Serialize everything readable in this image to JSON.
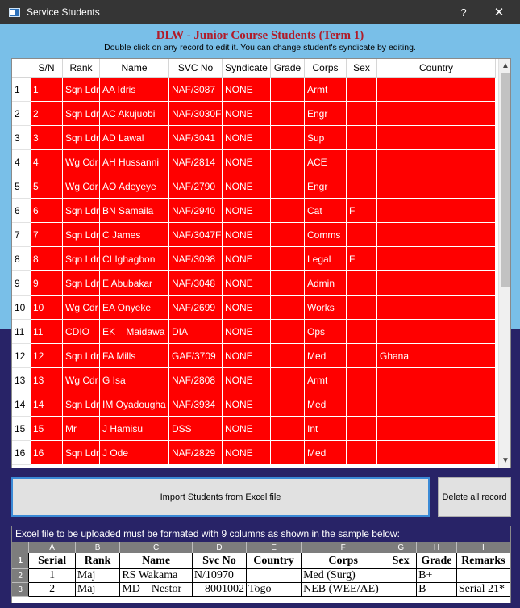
{
  "window": {
    "title": "Service Students",
    "help_label": "?",
    "close_label": "✕"
  },
  "heading": "DLW - Junior Course Students (Term 1)",
  "subheading": "Double click on any record to edit it. You can change student's syndicate by editing.",
  "colors": {
    "row_bg": "#ff0000",
    "top_bg": "#79bfe8",
    "bottom_bg": "#282367",
    "heading": "#b01c2a"
  },
  "table": {
    "columns": [
      "S/N",
      "Rank",
      "Name",
      "SVC No",
      "Syndicate",
      "Grade",
      "Corps",
      "Sex",
      "Country"
    ],
    "rows": [
      {
        "rn": "1",
        "sn": "1",
        "rank": "Sqn Ldr",
        "name": "AA Idris",
        "svc": "NAF/3087",
        "syndicate": "NONE",
        "grade": "",
        "corps": "Armt",
        "sex": "",
        "country": ""
      },
      {
        "rn": "2",
        "sn": "2",
        "rank": "Sqn Ldr",
        "name": "AC Akujuobi",
        "svc": "NAF/3030F",
        "syndicate": "NONE",
        "grade": "",
        "corps": "Engr",
        "sex": "",
        "country": ""
      },
      {
        "rn": "3",
        "sn": "3",
        "rank": "Sqn Ldr",
        "name": "AD Lawal",
        "svc": "NAF/3041",
        "syndicate": "NONE",
        "grade": "",
        "corps": "Sup",
        "sex": "",
        "country": ""
      },
      {
        "rn": "4",
        "sn": "4",
        "rank": "Wg Cdr",
        "name": "AH Hussanni",
        "svc": "NAF/2814",
        "syndicate": "NONE",
        "grade": "",
        "corps": "ACE",
        "sex": "",
        "country": ""
      },
      {
        "rn": "5",
        "sn": "5",
        "rank": "Wg Cdr",
        "name": "AO Adeyeye",
        "svc": "NAF/2790",
        "syndicate": "NONE",
        "grade": "",
        "corps": "Engr",
        "sex": "",
        "country": ""
      },
      {
        "rn": "6",
        "sn": "6",
        "rank": "Sqn Ldr",
        "name": "BN Samaila",
        "svc": "NAF/2940",
        "syndicate": "NONE",
        "grade": "",
        "corps": "Cat",
        "sex": "F",
        "country": ""
      },
      {
        "rn": "7",
        "sn": "7",
        "rank": "Sqn Ldr",
        "name": "C James",
        "svc": "NAF/3047F",
        "syndicate": "NONE",
        "grade": "",
        "corps": "Comms",
        "sex": "",
        "country": ""
      },
      {
        "rn": "8",
        "sn": "8",
        "rank": "Sqn Ldr",
        "name": "CI Ighagbon",
        "svc": "NAF/3098",
        "syndicate": "NONE",
        "grade": "",
        "corps": "Legal",
        "sex": "F",
        "country": ""
      },
      {
        "rn": "9",
        "sn": "9",
        "rank": "Sqn Ldr",
        "name": "E Abubakar",
        "svc": "NAF/3048",
        "syndicate": "NONE",
        "grade": "",
        "corps": "Admin",
        "sex": "",
        "country": ""
      },
      {
        "rn": "10",
        "sn": "10",
        "rank": "Wg Cdr",
        "name": "EA Onyeke",
        "svc": "NAF/2699",
        "syndicate": "NONE",
        "grade": "",
        "corps": "Works",
        "sex": "",
        "country": ""
      },
      {
        "rn": "11",
        "sn": "11",
        "rank": "CDIO",
        "name": "EK    Maidawa",
        "svc": "DIA",
        "syndicate": "NONE",
        "grade": "",
        "corps": "Ops",
        "sex": "",
        "country": ""
      },
      {
        "rn": "12",
        "sn": "12",
        "rank": "Sqn Ldr",
        "name": "FA Mills",
        "svc": "GAF/3709",
        "syndicate": "NONE",
        "grade": "",
        "corps": "Med",
        "sex": "",
        "country": "Ghana"
      },
      {
        "rn": "13",
        "sn": "13",
        "rank": "Wg Cdr",
        "name": "G Isa",
        "svc": "NAF/2808",
        "syndicate": "NONE",
        "grade": "",
        "corps": "Armt",
        "sex": "",
        "country": ""
      },
      {
        "rn": "14",
        "sn": "14",
        "rank": "Sqn Ldr",
        "name": "IM Oyadougha",
        "svc": "NAF/3934",
        "syndicate": "NONE",
        "grade": "",
        "corps": "Med",
        "sex": "",
        "country": ""
      },
      {
        "rn": "15",
        "sn": "15",
        "rank": "Mr",
        "name": "J Hamisu",
        "svc": "DSS",
        "syndicate": "NONE",
        "grade": "",
        "corps": "Int",
        "sex": "",
        "country": ""
      },
      {
        "rn": "16",
        "sn": "16",
        "rank": "Sqn Ldr",
        "name": "J Ode",
        "svc": "NAF/2829",
        "syndicate": "NONE",
        "grade": "",
        "corps": "Med",
        "sex": "",
        "country": ""
      }
    ]
  },
  "buttons": {
    "import_label": "Import Students from Excel file",
    "delete_label": "Delete all record"
  },
  "sample": {
    "note": "Excel file to be uploaded must be formated with 9 columns as shown in the sample below:",
    "col_letters": [
      "A",
      "B",
      "C",
      "D",
      "E",
      "F",
      "G",
      "H",
      "I"
    ],
    "row_numbers": [
      "1",
      "2",
      "3"
    ],
    "header": [
      "Serial",
      "Rank",
      "Name",
      "Svc No",
      "Country",
      "Corps",
      "Sex",
      "Grade",
      "Remarks"
    ],
    "row1": [
      "1",
      "Maj",
      "RS Wakama",
      "N/10970",
      "",
      "Med (Surg)",
      "",
      "B+",
      ""
    ],
    "row2": [
      "2",
      "Maj",
      "MD    Nestor",
      "8001002",
      "Togo",
      "NEB (WEE/AE)",
      "",
      "B",
      "Serial 21*"
    ]
  }
}
